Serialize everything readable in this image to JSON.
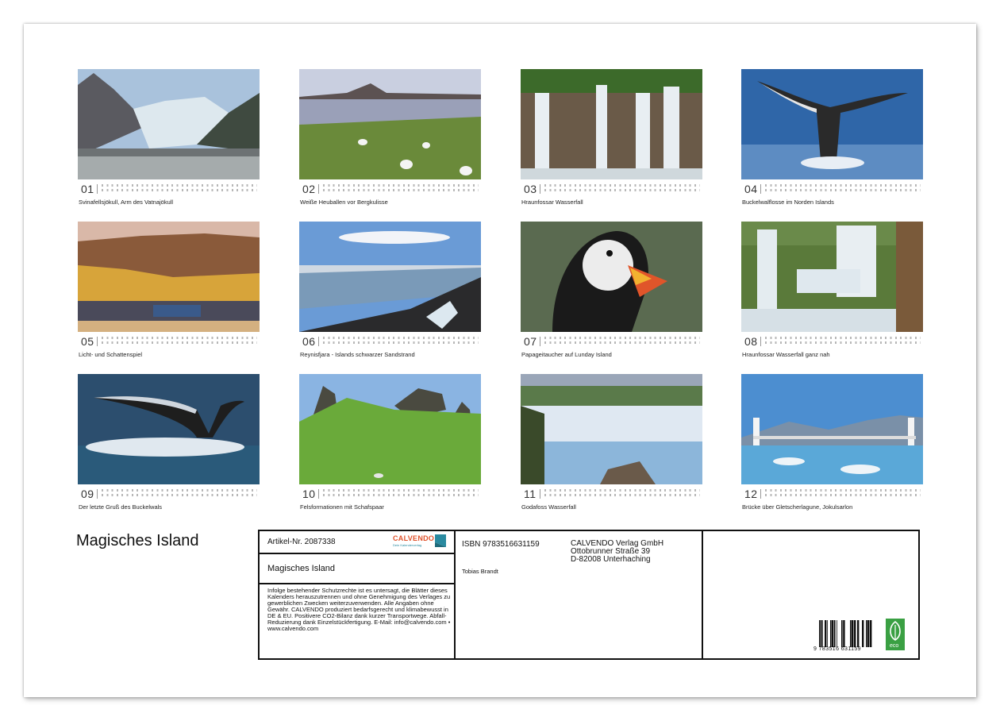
{
  "calendar_title": "Magisches Island",
  "months": [
    {
      "number": "01",
      "caption": "Svinafellsjökull, Arm des Vatnajökull",
      "image": "glacier-photo"
    },
    {
      "number": "02",
      "caption": "Weiße Heuballen vor Bergkulisse",
      "image": "hay-bales-photo"
    },
    {
      "number": "03",
      "caption": "Hraunfossar Wasserfall",
      "image": "waterfall-photo"
    },
    {
      "number": "04",
      "caption": "Buckelwalflosse im Norden Islands",
      "image": "whale-fluke-photo"
    },
    {
      "number": "05",
      "caption": "Licht- und Schattenspiel",
      "image": "harbour-mountain-photo"
    },
    {
      "number": "06",
      "caption": "Reynisfjara - Islands schwarzer Sandstrand",
      "image": "black-beach-photo"
    },
    {
      "number": "07",
      "caption": "Papageitaucher auf Lunday Island",
      "image": "puffin-photo"
    },
    {
      "number": "08",
      "caption": "Hraunfossar Wasserfall ganz nah",
      "image": "waterfall-closeup-photo"
    },
    {
      "number": "09",
      "caption": "Der letzte Gruß des Buckelwals",
      "image": "whale-tail-photo"
    },
    {
      "number": "10",
      "caption": "Felsformationen mit Schafspaar",
      "image": "rock-formations-photo"
    },
    {
      "number": "11",
      "caption": "Godafoss Wasserfall",
      "image": "godafoss-photo"
    },
    {
      "number": "12",
      "caption": "Brücke über Gletscherlagune, Jokulsarlon",
      "image": "bridge-lagoon-photo"
    }
  ],
  "info": {
    "article_number": "Artikel-Nr. 2087338",
    "publisher_logo": "CALVENDO",
    "publisher_logo_tagline": "Dein Kalenderverlag",
    "product_title": "Magisches Island",
    "legal_text": "Infolge bestehender Schutzrechte ist es untersagt, die Blätter dieses Kalenders herauszutrennen und ohne Genehmigung des Verlages zu gewerblichen Zwecken weiterzuverwenden. Alle Angaben ohne Gewähr. CALVENDO produziert bedarfsgerecht und klimabewusst in DE & EU. Positivere CO2-Bilanz dank kurzer Transportwege. Abfall-Reduzierung dank Einzelstückfertigung. E-Mail: info@calvendo.com • www.calvendo.com",
    "isbn": "ISBN 9783516631159",
    "author": "Tobias Brandt",
    "publisher_name": "CALVENDO Verlag GmbH",
    "publisher_street": "Ottobrunner Straße 39",
    "publisher_city": "D-82008 Unterhaching",
    "barcode_digits": "9 783516 631159",
    "eco_label": "eco"
  }
}
